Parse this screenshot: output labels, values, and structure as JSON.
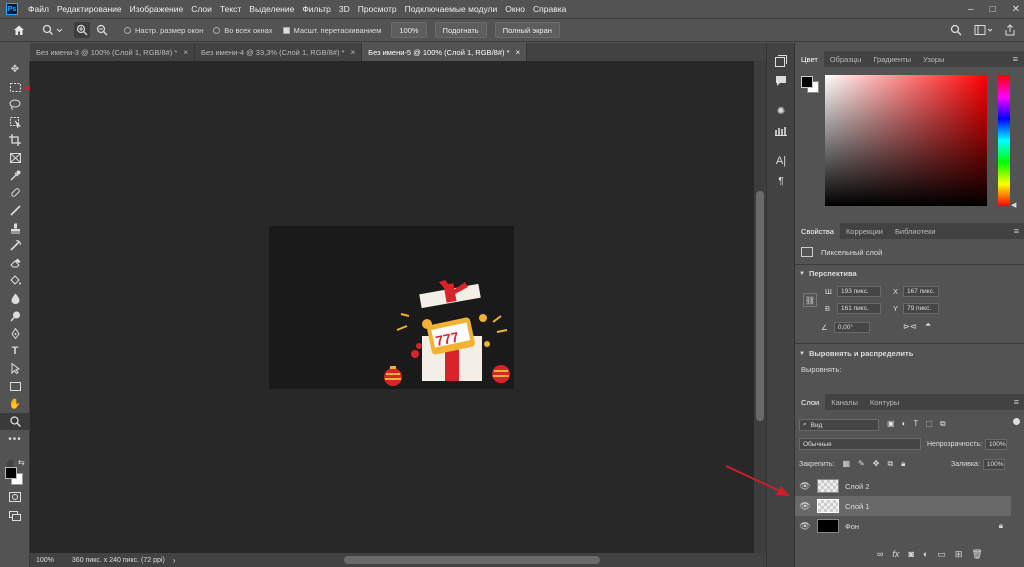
{
  "menubar": {
    "logo": "Ps",
    "items": [
      "Файл",
      "Редактирование",
      "Изображение",
      "Слои",
      "Текст",
      "Выделение",
      "Фильтр",
      "3D",
      "Просмотр",
      "Подключаемые модули",
      "Окно",
      "Справка"
    ]
  },
  "options": {
    "resize_windows": "Настр. размер окон",
    "all_windows": "Во всех окнах",
    "scrubby_zoom": "Масшт. перетаскиванием",
    "zoom_value": "100%",
    "fit_button": "Подогнать",
    "fullscreen_button": "Полный экран"
  },
  "tabs": [
    {
      "label": "Без имени-3 @ 100% (Слой 1, RGB/8#) *",
      "active": false
    },
    {
      "label": "Без имени-4 @ 33,3% (Слой 1, RGB/8#) *",
      "active": false
    },
    {
      "label": "Без имени-5 @ 100% (Слой 1, RGB/8#) *",
      "active": true
    }
  ],
  "status": {
    "zoom": "100%",
    "doc_info": "360 пикс. x 240 пикс. (72 ppi)"
  },
  "color_panel": {
    "tabs": [
      "Цвет",
      "Образцы",
      "Градиенты",
      "Узоры"
    ],
    "foreground": "#000000",
    "background": "#ffffff",
    "picker_hue": "#ff0000"
  },
  "properties_panel": {
    "tabs": [
      "Свойства",
      "Коррекции",
      "Библиотеки"
    ],
    "layer_kind": "Пиксельный слой",
    "transform_title": "Перспектива",
    "w_label": "Ш",
    "w_value": "193 пикс.",
    "h_label": "В",
    "h_value": "161 пикс.",
    "x_label": "X",
    "x_value": "167 пикс.",
    "y_label": "Y",
    "y_value": "79 пикс.",
    "angle_value": "0,00°",
    "align_title": "Выровнять и распределить",
    "align_label": "Выровнять:"
  },
  "layers_panel": {
    "tabs": [
      "Слои",
      "Каналы",
      "Контуры"
    ],
    "filter_label": "Вид",
    "blend_mode": "Обычные",
    "opacity_label": "Непрозрачность:",
    "opacity_value": "100%",
    "lock_label": "Закрепить:",
    "fill_label": "Заливка:",
    "fill_value": "100%",
    "layers": [
      {
        "name": "Слой 2",
        "selected": false
      },
      {
        "name": "Слой 1",
        "selected": true
      },
      {
        "name": "Фон",
        "selected": false
      }
    ]
  },
  "colors": {
    "accent_arrow": "#cc1f2b",
    "ps_blue": "#31a8ff"
  }
}
